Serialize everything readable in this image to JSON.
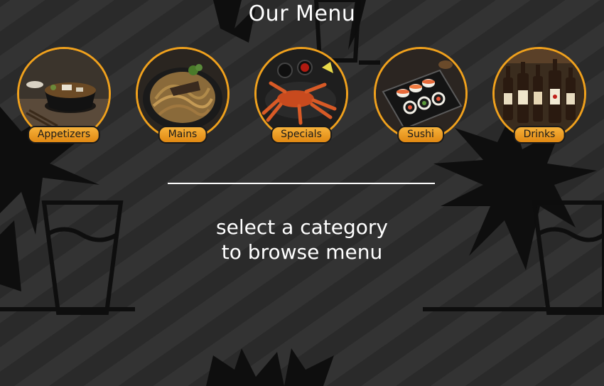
{
  "header": {
    "title": "Our Menu"
  },
  "categories": [
    {
      "label": "Appetizers"
    },
    {
      "label": "Mains"
    },
    {
      "label": "Specials"
    },
    {
      "label": "Sushi"
    },
    {
      "label": "Drinks"
    }
  ],
  "main": {
    "prompt_line1": "select a category",
    "prompt_line2": "to browse menu"
  },
  "colors": {
    "accent": "#f0a11d",
    "background": "#2f2f2f",
    "text": "#ffffff"
  }
}
